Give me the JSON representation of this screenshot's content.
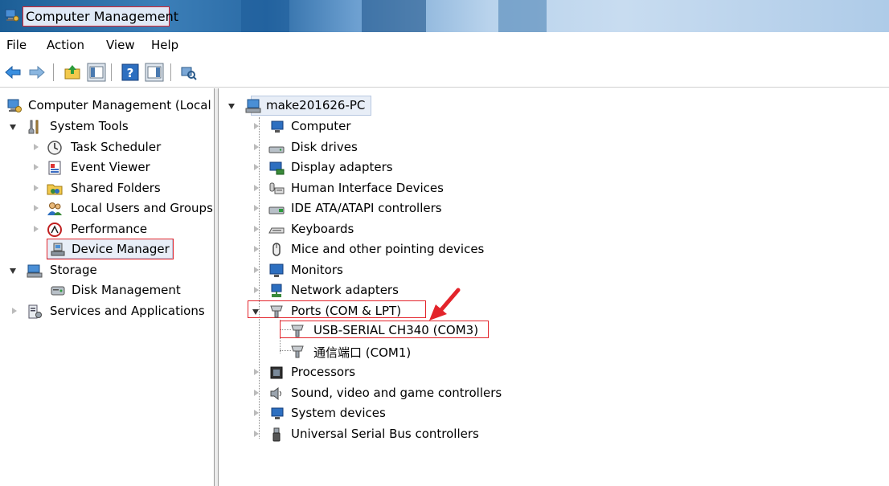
{
  "window": {
    "title": "Computer Management"
  },
  "menu": [
    "File",
    "Action",
    "View",
    "Help"
  ],
  "left_tree": [
    {
      "label": "Computer Management (Local",
      "icon": "computer-management-icon"
    },
    {
      "label": "System Tools",
      "icon": "tools-icon"
    },
    {
      "label": "Task Scheduler",
      "icon": "clock-icon"
    },
    {
      "label": "Event Viewer",
      "icon": "event-viewer-icon"
    },
    {
      "label": "Shared Folders",
      "icon": "shared-folder-icon"
    },
    {
      "label": "Local Users and Groups",
      "icon": "users-icon"
    },
    {
      "label": "Performance",
      "icon": "performance-icon"
    },
    {
      "label": "Device Manager",
      "icon": "device-manager-icon"
    },
    {
      "label": "Storage",
      "icon": "storage-icon"
    },
    {
      "label": "Disk Management",
      "icon": "disk-icon"
    },
    {
      "label": "Services and Applications",
      "icon": "services-icon"
    }
  ],
  "device_tree": {
    "root": "make201626-PC",
    "categories": [
      {
        "label": "Computer",
        "icon": "computer-icon"
      },
      {
        "label": "Disk drives",
        "icon": "disk-drive-icon"
      },
      {
        "label": "Display adapters",
        "icon": "display-adapter-icon"
      },
      {
        "label": "Human Interface Devices",
        "icon": "hid-icon"
      },
      {
        "label": "IDE ATA/ATAPI controllers",
        "icon": "ide-controller-icon"
      },
      {
        "label": "Keyboards",
        "icon": "keyboard-icon"
      },
      {
        "label": "Mice and other pointing devices",
        "icon": "mouse-icon"
      },
      {
        "label": "Monitors",
        "icon": "monitor-icon"
      },
      {
        "label": "Network adapters",
        "icon": "network-adapter-icon"
      },
      {
        "label": "Ports (COM & LPT)",
        "icon": "port-icon"
      },
      {
        "label": "Processors",
        "icon": "processor-icon"
      },
      {
        "label": "Sound, video and game controllers",
        "icon": "sound-icon"
      },
      {
        "label": "System devices",
        "icon": "system-device-icon"
      },
      {
        "label": "Universal Serial Bus controllers",
        "icon": "usb-icon"
      }
    ],
    "ports_children": [
      {
        "label": "USB-SERIAL CH340 (COM3)",
        "icon": "port-icon"
      },
      {
        "label": "通信端口 (COM1)",
        "icon": "port-icon"
      }
    ]
  },
  "colors": {
    "highlight_border": "#e3242b",
    "arrow": "#e3242b"
  }
}
